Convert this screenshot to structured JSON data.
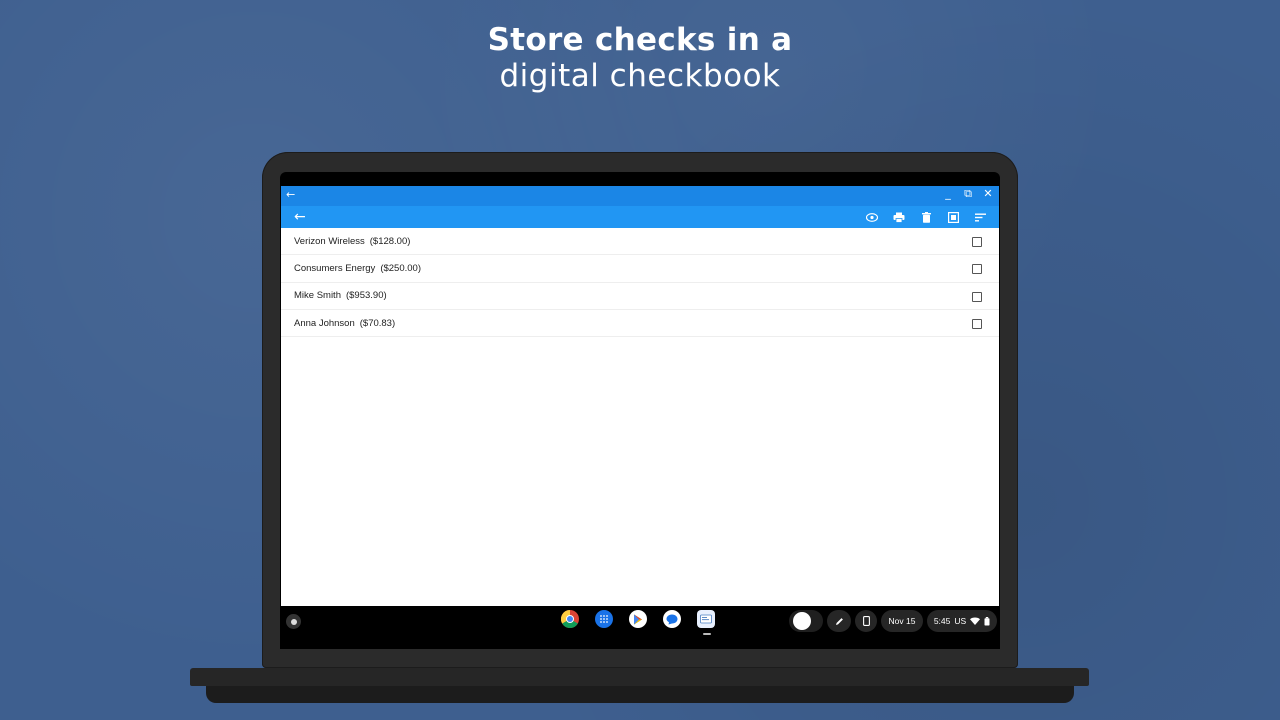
{
  "headline": {
    "line1": "Store checks in a",
    "line2": "digital checkbook"
  },
  "window": {
    "controls": {
      "back": "←",
      "minimize": "_",
      "restore": "⧉",
      "close": "✕"
    }
  },
  "toolbar": {
    "back": "←",
    "actions": [
      "eye-icon",
      "print-icon",
      "delete-icon",
      "select-all-icon",
      "sort-icon"
    ]
  },
  "checks": [
    {
      "payee": "Verizon Wireless",
      "amount": "($128.00)",
      "checked": false
    },
    {
      "payee": "Consumers Energy",
      "amount": "($250.00)",
      "checked": false
    },
    {
      "payee": "Mike Smith",
      "amount": "($953.90)",
      "checked": false
    },
    {
      "payee": "Anna Johnson",
      "amount": "($70.83)",
      "checked": false
    }
  ],
  "shelf": {
    "apps": [
      "chrome-icon",
      "app-launcher-grid-icon",
      "play-store-icon",
      "messages-icon",
      "checkbook-app-icon"
    ],
    "date": "Nov 15",
    "time": "5:45",
    "locale": "US"
  },
  "colors": {
    "background": "#3e5f8f",
    "titlebar": "#1b86e6",
    "toolbar": "#2196f3"
  }
}
